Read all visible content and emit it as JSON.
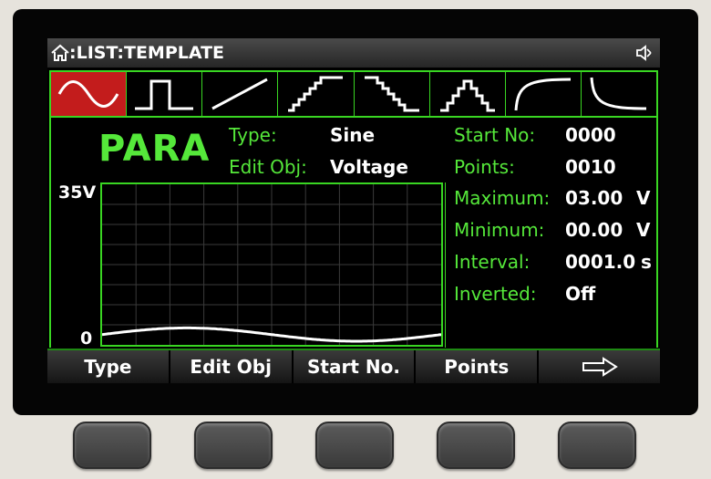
{
  "title": ":LIST:TEMPLATE",
  "waveforms": [
    {
      "name": "sine",
      "active": true
    },
    {
      "name": "square"
    },
    {
      "name": "ramp"
    },
    {
      "name": "staircase-up"
    },
    {
      "name": "staircase-down"
    },
    {
      "name": "triangle-stairs"
    },
    {
      "name": "rise-exponential"
    },
    {
      "name": "fall-exponential"
    }
  ],
  "mode": "PARA",
  "params_left": [
    {
      "label": "Type:",
      "value": "Sine"
    },
    {
      "label": "Edit Obj:",
      "value": "Voltage"
    }
  ],
  "params_right": [
    {
      "label": "Start No:",
      "value": "0000",
      "unit": ""
    },
    {
      "label": "Points:",
      "value": "0010",
      "unit": ""
    },
    {
      "label": "Maximum:",
      "value": "03.00",
      "unit": "V"
    },
    {
      "label": "Minimum:",
      "value": "00.00",
      "unit": "V"
    },
    {
      "label": "Interval:",
      "value": "0001.0",
      "unit": "s"
    },
    {
      "label": "Inverted:",
      "value": "Off",
      "unit": ""
    }
  ],
  "graph": {
    "y_max_label": "35V",
    "y_min_label": "0",
    "y_max": 35,
    "amplitude_max": 3.0,
    "amplitude_min": 0.0
  },
  "softkeys": [
    {
      "label": "Type"
    },
    {
      "label": "Edit Obj"
    },
    {
      "label": "Start No."
    },
    {
      "label": "Points"
    },
    {
      "label": "",
      "icon": "arrow-right-icon"
    }
  ],
  "colors": {
    "accent": "#55e83a",
    "active_wave": "#c31c1c"
  }
}
